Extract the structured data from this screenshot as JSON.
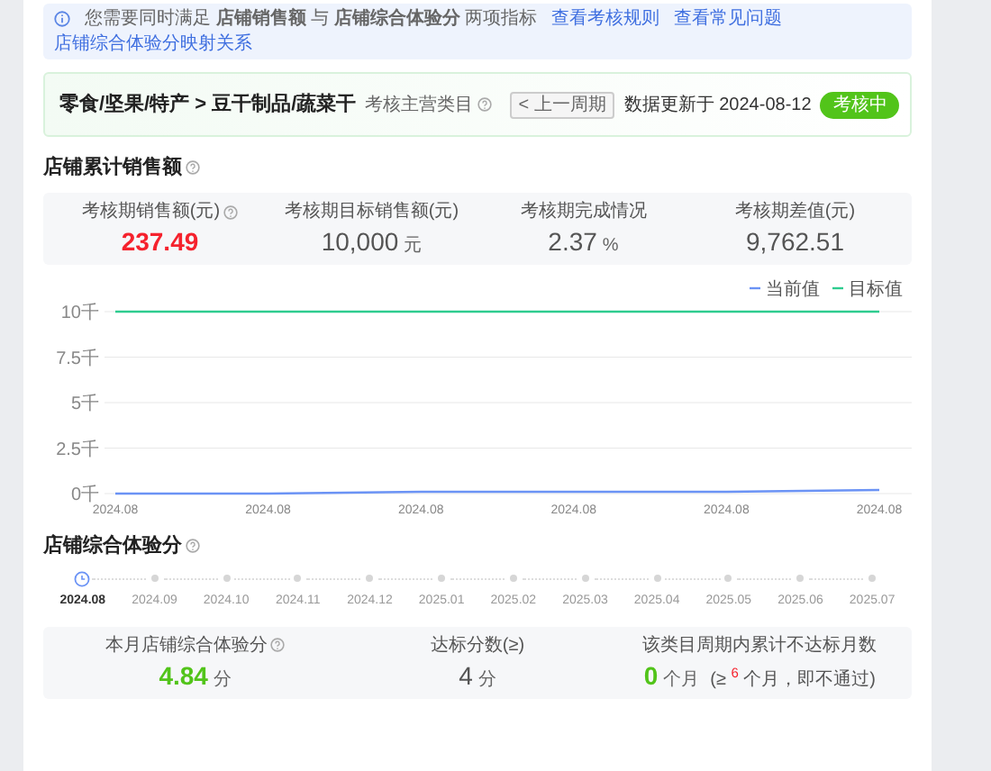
{
  "notice": {
    "text": "您需要同时满足 **店铺销售额** 与 **店铺综合体验分** 两项指标",
    "links": [
      "查看考核规则",
      "查看常见问题",
      "店铺综合体验分映射关系"
    ]
  },
  "header": {
    "category": "零食/坚果/特产 > 豆干制品/蔬菜干",
    "category_note": "考核主营类目",
    "prev_button": "< 上一周期",
    "updated": "数据更新于 2024-08-12",
    "status": "考核中"
  },
  "sales": {
    "title": "店铺累计销售额",
    "stats": [
      {
        "label": "考核期销售额(元)",
        "value": "237.49",
        "help": true,
        "color": "#f5222d"
      },
      {
        "label": "考核期目标销售额(元)",
        "value": "10,000",
        "unit": "元",
        "help": false
      },
      {
        "label": "考核期完成情况",
        "value": "2.37",
        "unit": "%",
        "help": false
      },
      {
        "label": "考核期差值(元)",
        "value": "9,762.51",
        "help": false
      }
    ],
    "chart_data": {
      "type": "line",
      "grid": true,
      "legend": "top-right",
      "categories": [
        "2024.08",
        "2024.08",
        "2024.08",
        "2024.08",
        "2024.08",
        "2024.08"
      ],
      "ylim": [
        0,
        10
      ],
      "yticks": [
        {
          "value": 0,
          "label": "0千"
        },
        {
          "value": 2.5,
          "label": "2.5千"
        },
        {
          "value": 5,
          "label": "5千"
        },
        {
          "value": 7.5,
          "label": "7.5千"
        },
        {
          "value": 10,
          "label": "10千"
        }
      ],
      "series": [
        {
          "name": "当前值",
          "color": "#6b93f5",
          "values": [
            0,
            0,
            0.1,
            0.1,
            0.1,
            0.2
          ]
        },
        {
          "name": "目标值",
          "color": "#2ecc8f",
          "values": [
            10,
            10,
            10,
            10,
            10,
            10
          ]
        }
      ]
    }
  },
  "experience": {
    "title": "店铺综合体验分",
    "months": [
      {
        "label": "2024.08",
        "selected": true
      },
      {
        "label": "2024.09",
        "selected": false
      },
      {
        "label": "2024.10",
        "selected": false
      },
      {
        "label": "2024.11",
        "selected": false
      },
      {
        "label": "2024.12",
        "selected": false
      },
      {
        "label": "2025.01",
        "selected": false
      },
      {
        "label": "2025.02",
        "selected": false
      },
      {
        "label": "2025.03",
        "selected": false
      },
      {
        "label": "2025.04",
        "selected": false
      },
      {
        "label": "2025.05",
        "selected": false
      },
      {
        "label": "2025.06",
        "selected": false
      },
      {
        "label": "2025.07",
        "selected": false
      }
    ],
    "stats": [
      {
        "label": "本月店铺综合体验分",
        "value": "4.84",
        "unit": "分",
        "help": true,
        "color": "#52c41a"
      },
      {
        "label": "达标分数(≥)",
        "value": "4",
        "unit": "分",
        "help": false
      },
      {
        "label": "该类目周期内累计不达标月数",
        "value": "0",
        "unit": "个月",
        "help": false,
        "color": "#52c41a",
        "note": "(≥ $^{6}$ 个月，即不通过)"
      }
    ]
  }
}
